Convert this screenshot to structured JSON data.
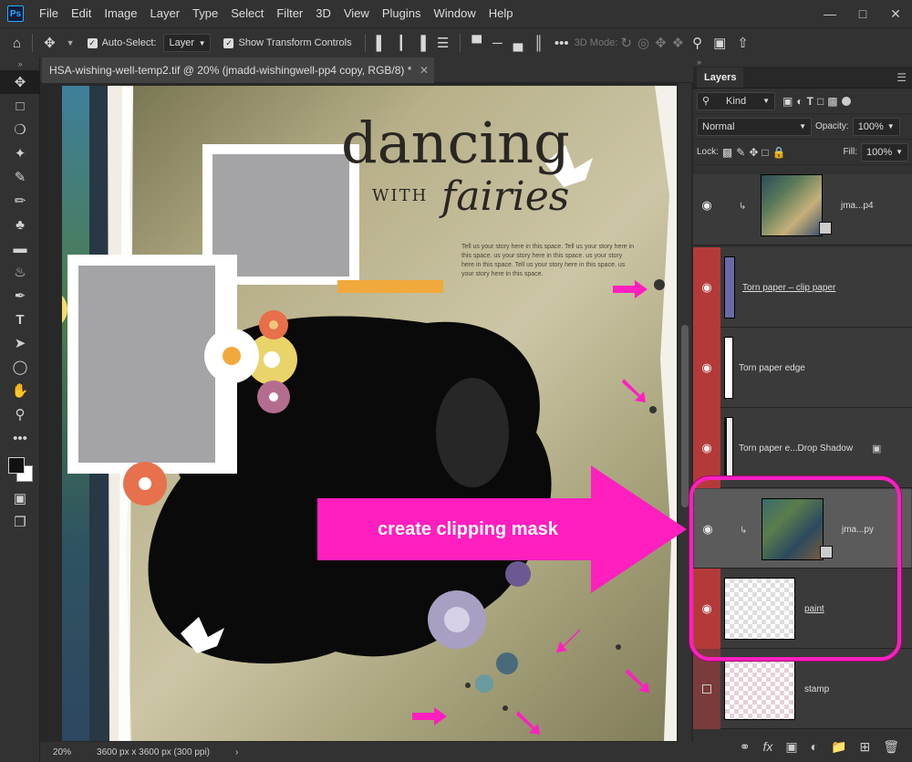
{
  "app": {
    "logo": "Ps"
  },
  "menu": [
    "File",
    "Edit",
    "Image",
    "Layer",
    "Type",
    "Select",
    "Filter",
    "3D",
    "View",
    "Plugins",
    "Window",
    "Help"
  ],
  "options": {
    "auto_select_label": "Auto-Select:",
    "auto_select_target": "Layer",
    "show_transform_label": "Show Transform Controls",
    "mode_3d_label": "3D Mode:"
  },
  "document": {
    "tab_title": "HSA-wishing-well-temp2.tif @ 20% (jmadd-wishingwell-pp4 copy, RGB/8) *",
    "zoom": "20%",
    "dimensions": "3600 px x 3600 px (300 ppi)"
  },
  "artwork": {
    "title_main": "dancing",
    "title_with": "WITH",
    "title_fairies": "fairies",
    "journal_text": "Tell us your story here in this space. Tell us your story here in this space. us your story here in this space. us your story here in this space. Tell us your story here in this space. us your story here in this space."
  },
  "annotation": {
    "arrow_label": "create clipping mask",
    "color": "#ff1fbf"
  },
  "layers_panel": {
    "tab_label": "Layers",
    "filter_kind": "Kind",
    "blend_mode": "Normal",
    "opacity_label": "Opacity:",
    "opacity_value": "100%",
    "lock_label": "Lock:",
    "fill_label": "Fill:",
    "fill_value": "100%",
    "layers": [
      {
        "name": "jma...p4",
        "clipped": true
      },
      {
        "name": "Torn paper – clip paper",
        "clipped": false
      },
      {
        "name": "Torn paper edge",
        "clipped": false
      },
      {
        "name": "Torn paper e...Drop Shadow",
        "clipped": false
      },
      {
        "name": "jma...py",
        "clipped": true,
        "selected": true
      },
      {
        "name": "paint",
        "clipped": false
      },
      {
        "name": "stamp",
        "clipped": false
      }
    ]
  },
  "colors": {
    "layer_red": "#b43a3a",
    "accent_pink": "#ff1fbf"
  }
}
